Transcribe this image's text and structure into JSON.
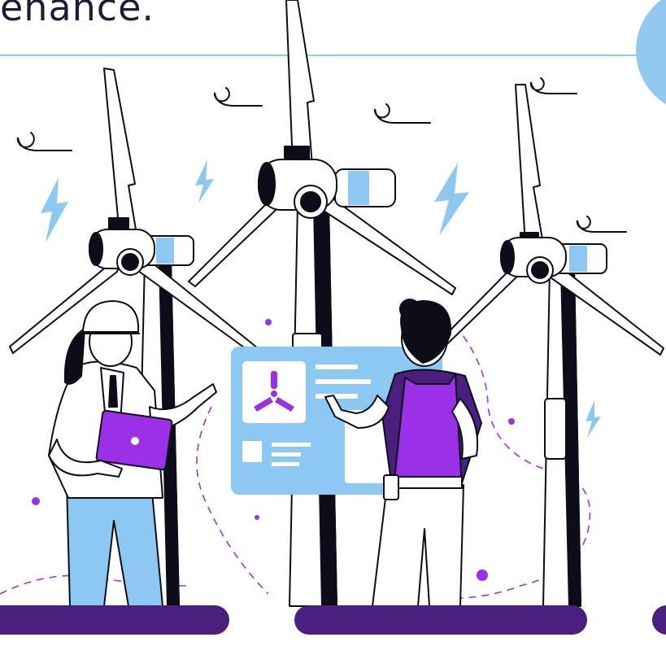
{
  "heading": {
    "title": "enance."
  },
  "colors": {
    "outline": "#0d0d1a",
    "light_blue": "#8dc8f2",
    "purple": "#9b30e6",
    "deep_purple": "#4a1f7e",
    "accent_line": "#8fc9f0",
    "circle_accent": "#8fc9f0",
    "skin": "#ffffff",
    "hair": "#0d0d1a"
  },
  "icons": {
    "bolts": [
      "lightning-bolt-icon",
      "lightning-bolt-icon",
      "lightning-bolt-icon",
      "lightning-bolt-icon"
    ],
    "wind": [
      "wind-swirl-icon",
      "wind-swirl-icon",
      "wind-swirl-icon",
      "wind-swirl-icon",
      "wind-swirl-icon"
    ],
    "screen": [
      "turbine-symbol-icon"
    ]
  }
}
